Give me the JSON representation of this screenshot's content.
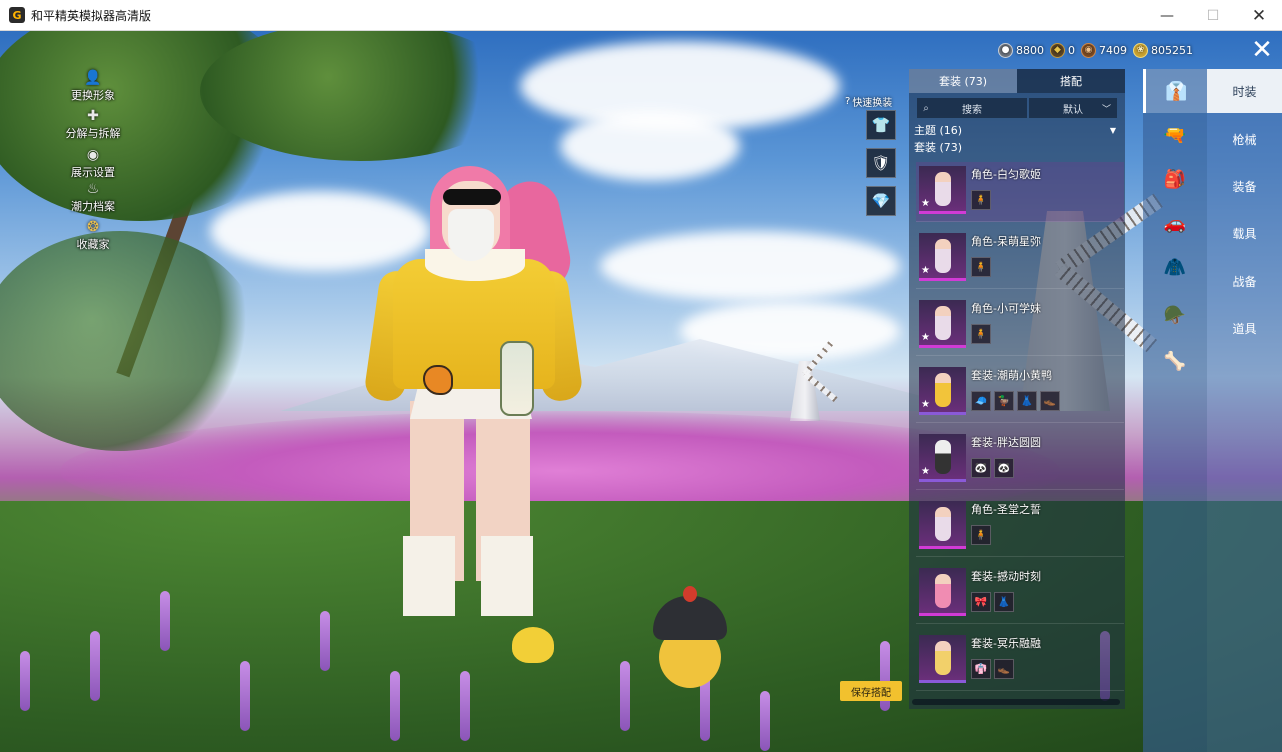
{
  "window": {
    "title": "和平精英模拟器高清版",
    "minimize_glyph": "—",
    "maximize_glyph": "☐",
    "close_glyph": "✕"
  },
  "left_menu": [
    {
      "label": "更换形象",
      "icon": "person-icon"
    },
    {
      "label": "分解与拆解",
      "icon": "puzzle-icon"
    },
    {
      "label": "展示设置",
      "icon": "eye-icon"
    },
    {
      "label": "潮力档案",
      "icon": "flame-icon"
    },
    {
      "label": "收藏家",
      "icon": "collector-badge-icon"
    }
  ],
  "currency": [
    {
      "value": "8800",
      "icon": "uc-coin-icon",
      "color": "#9aa3ad"
    },
    {
      "value": "0",
      "icon": "badge-coin-icon",
      "color": "#c79a3a"
    },
    {
      "value": "7409",
      "icon": "bronze-coin-icon",
      "color": "#b7743a"
    },
    {
      "value": "805251",
      "icon": "gold-coin-icon",
      "color": "#e5c24a"
    }
  ],
  "quick_change": {
    "label": "快速换装",
    "buttons": [
      {
        "name": "outfit-quick",
        "glyph": "👕"
      },
      {
        "name": "emblem-quick",
        "glyph": "🛡"
      },
      {
        "name": "gem-quick",
        "glyph": "💎"
      }
    ]
  },
  "panel": {
    "tabs": [
      {
        "label": "套装 (73)",
        "active": true
      },
      {
        "label": "搭配",
        "active": false
      }
    ],
    "search_placeholder": "搜索",
    "sort_value": "默认",
    "sections": [
      "主题 (16)",
      "套装 (73)"
    ],
    "items": [
      {
        "name": "角色-白匀歌姬",
        "pieces": [
          "🧍"
        ]
      },
      {
        "name": "角色-呆萌星弥",
        "pieces": [
          "🧍"
        ]
      },
      {
        "name": "角色-小可学妹",
        "pieces": [
          "🧍"
        ]
      },
      {
        "name": "套装-潮萌小黄鸭",
        "pieces": [
          "🧢",
          "🦆",
          "👗",
          "👞"
        ]
      },
      {
        "name": "套装-胖达圆圆",
        "pieces": [
          "🐼",
          "🐼"
        ]
      },
      {
        "name": "角色-圣堂之誓",
        "pieces": [
          "🧍"
        ]
      },
      {
        "name": "套装-撼动时刻",
        "pieces": [
          "🎀",
          "👗"
        ]
      },
      {
        "name": "套装-冥乐融融",
        "pieces": [
          "👘",
          "👞"
        ]
      }
    ]
  },
  "save_button": "保存搭配",
  "close_label": "✕",
  "icon_rail": [
    {
      "name": "outfit-hanger-icon",
      "glyph": "👔",
      "active": true
    },
    {
      "name": "gun-skin-icon",
      "glyph": "🔫"
    },
    {
      "name": "equipment-icon",
      "glyph": "🎒"
    },
    {
      "name": "vehicle-icon",
      "glyph": "🚗"
    },
    {
      "name": "clothing-icon",
      "glyph": "🧥"
    },
    {
      "name": "combat-gear-icon",
      "glyph": "🪖"
    },
    {
      "name": "item-props-icon",
      "glyph": "🦴"
    }
  ],
  "categories": [
    {
      "label": "时装",
      "active": true
    },
    {
      "label": "枪械",
      "active": false
    },
    {
      "label": "装备",
      "active": false
    },
    {
      "label": "载具",
      "active": false
    },
    {
      "label": "战备",
      "active": false
    },
    {
      "label": "道具",
      "active": false
    }
  ]
}
